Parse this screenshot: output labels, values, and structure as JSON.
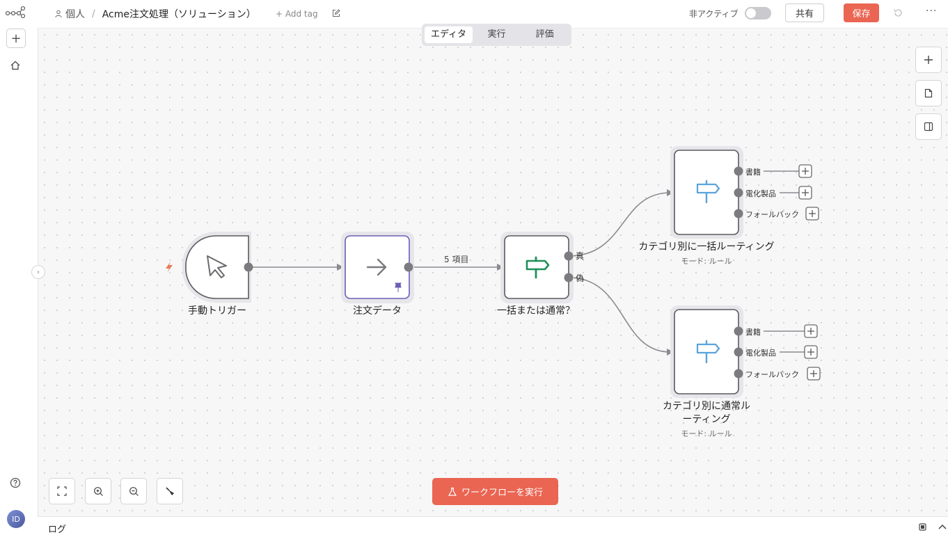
{
  "header": {
    "project": "個人",
    "workflow_name": "Acme注文処理（ソリューション）",
    "add_tag": "+ Add tag",
    "active_label": "非アクティブ",
    "share_label": "共有",
    "save_label": "保存"
  },
  "tabs": [
    {
      "label": "エディタ",
      "active": true
    },
    {
      "label": "実行",
      "active": false
    },
    {
      "label": "評価",
      "active": false
    }
  ],
  "nodes": {
    "trigger": {
      "label": "手動トリガー"
    },
    "order_data": {
      "label": "注文データ"
    },
    "bulk_or_normal": {
      "label": "一括または通常？",
      "true_label": "真",
      "false_label": "偽"
    },
    "bulk_routing": {
      "label": "カテゴリ別に一括ルーティング",
      "sub": "モード: ルール",
      "outputs": [
        "書籍",
        "電化製品",
        "フォールバック"
      ]
    },
    "normal_routing": {
      "label_line1": "カテゴリ別に通常ル",
      "label_line2": "ーティング",
      "sub": "モード: ルール",
      "outputs": [
        "書籍",
        "電化製品",
        "フォールバック"
      ]
    }
  },
  "edges": {
    "items_label": "5 項目"
  },
  "run_button": "ワークフローを実行",
  "log": {
    "label": "ログ"
  },
  "user": {
    "initials": "ID"
  },
  "colors": {
    "accent": "#ea6552",
    "node_border": "#5a5a5e",
    "selected_border": "#6b5fb5",
    "routing_icon": "#5aa4dc",
    "if_icon": "#1f8f5a"
  }
}
